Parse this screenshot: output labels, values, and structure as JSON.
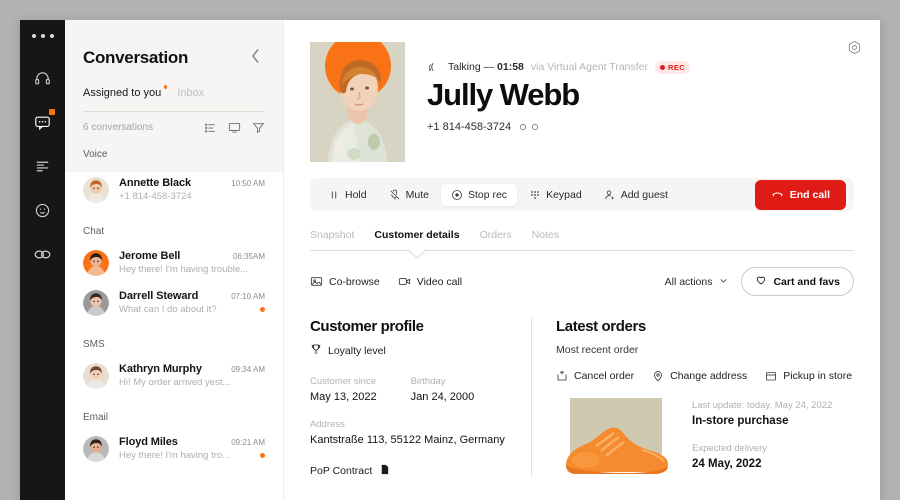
{
  "window": {
    "frame_bg": "#b2b2b2",
    "app_bg": "#ffffff"
  },
  "rail": {
    "dots": "···",
    "items": [
      {
        "icon": "headset-icon",
        "label": "Support",
        "active": false,
        "badge": false
      },
      {
        "icon": "chat-bubble-icon",
        "label": "Conversations",
        "active": true,
        "badge": true
      },
      {
        "icon": "list-icon",
        "label": "Queue",
        "active": false,
        "badge": false
      },
      {
        "icon": "smiley-icon",
        "label": "Customers",
        "active": false,
        "badge": false
      },
      {
        "icon": "link-icon",
        "label": "Integrations",
        "active": false,
        "badge": false
      }
    ]
  },
  "conversation": {
    "title": "Conversation",
    "collapse_icon": "chevron-left-icon",
    "tabs": [
      {
        "label": "Assigned to you",
        "selected": true,
        "dot": true
      },
      {
        "label": "Inbox",
        "selected": false,
        "dot": false
      }
    ],
    "count_text": "6 conversations",
    "meta_icons": [
      "sort-list-icon",
      "monitor-icon",
      "filter-funnel-icon"
    ],
    "groups": [
      {
        "label": "Voice",
        "items": [
          {
            "name": "Annette Black",
            "time": "10:50 AM",
            "sub": "+1 814-458-3724",
            "unread": false,
            "avatar_bg": "#e8e2d2",
            "hair": "#c8642a",
            "skin": "#f0cbb0"
          }
        ]
      },
      {
        "label": "Chat",
        "items": [
          {
            "name": "Jerome Bell",
            "time": "06:35AM",
            "sub": "Hey there! I'm having trouble...",
            "unread": false,
            "avatar_bg": "#f97316",
            "hair": "#2b1b14",
            "skin": "#e9b392"
          },
          {
            "name": "Darrell Steward",
            "time": "07:10 AM",
            "sub": "What can I do about it?",
            "unread": true,
            "avatar_bg": "#9a9a9a",
            "hair": "#3a2a22",
            "skin": "#efc4ad"
          }
        ]
      },
      {
        "label": "SMS",
        "items": [
          {
            "name": "Kathryn Murphy",
            "time": "09:34 AM",
            "sub": "Hi! My order arrived yest...",
            "unread": false,
            "avatar_bg": "#e6ded0",
            "hair": "#6b4a30",
            "skin": "#f2cfb6"
          }
        ]
      },
      {
        "label": "Email",
        "items": [
          {
            "name": "Floyd Miles",
            "time": "09:21 AM",
            "sub": "Hey there! I'm having tro...",
            "unread": true,
            "avatar_bg": "#b9b9b9",
            "hair": "#332219",
            "skin": "#e4b191"
          }
        ]
      }
    ]
  },
  "main": {
    "settings_icon": "gear-icon",
    "status": {
      "icon": "signal-icon",
      "state": "Talking — ",
      "timer": "01:58",
      "via": "via Virtual Agent Transfer",
      "rec_badge": "REC",
      "rec_color": "#e01b15"
    },
    "customer_name": "Jully Webb",
    "phone": "+1 814-458-3724",
    "phone_icons": [
      "copy-icon",
      "more-icon"
    ],
    "controls": [
      {
        "label": "Hold",
        "icon": "pause-icon",
        "active": false
      },
      {
        "label": "Mute",
        "icon": "mic-off-icon",
        "active": false
      },
      {
        "label": "Stop rec",
        "icon": "record-icon",
        "active": true
      },
      {
        "label": "Keypad",
        "icon": "keypad-icon",
        "active": false
      },
      {
        "label": "Add guest",
        "icon": "add-user-icon",
        "active": false
      }
    ],
    "end_call": {
      "label": "End call",
      "icon": "phone-hangup-icon",
      "color": "#e01b15"
    },
    "tabs": [
      {
        "label": "Snapshot",
        "selected": false
      },
      {
        "label": "Customer details",
        "selected": true
      },
      {
        "label": "Orders",
        "selected": false
      },
      {
        "label": "Notes",
        "selected": false
      }
    ],
    "quick_actions": [
      {
        "label": "Co-browse",
        "icon": "cobrowse-icon"
      },
      {
        "label": "Video call",
        "icon": "video-icon"
      }
    ],
    "all_actions": {
      "label": "All actions",
      "icon": "chevron-down-icon"
    },
    "cart_favs": {
      "label": "Cart and favs",
      "icon": "heart-icon"
    }
  },
  "customer_profile": {
    "title": "Customer profile",
    "loyalty": {
      "icon": "trophy-icon",
      "label": "Loyalty level"
    },
    "fields": [
      {
        "label": "Customer since",
        "value": "May 13, 2022"
      },
      {
        "label": "Birthday",
        "value": "Jan 24, 2000"
      }
    ],
    "address": {
      "label": "Address",
      "value": "Kantstraße 113, 55122 Mainz, Germany"
    },
    "pop": {
      "label": "PoP Contract",
      "icon": "document-icon"
    }
  },
  "latest_orders": {
    "title": "Latest orders",
    "subtitle": "Most recent order",
    "actions": [
      {
        "label": "Cancel order",
        "icon": "cancel-order-icon"
      },
      {
        "label": "Change address",
        "icon": "map-pin-icon"
      },
      {
        "label": "Pickup in store",
        "icon": "store-icon"
      }
    ],
    "order": {
      "product_image": "orange-sneaker",
      "last_update_label": "Last update: today, May 24, 2022",
      "type": "In-store purchase",
      "expected_label": "Expected delivery",
      "expected_value": "24 May, 2022"
    }
  }
}
